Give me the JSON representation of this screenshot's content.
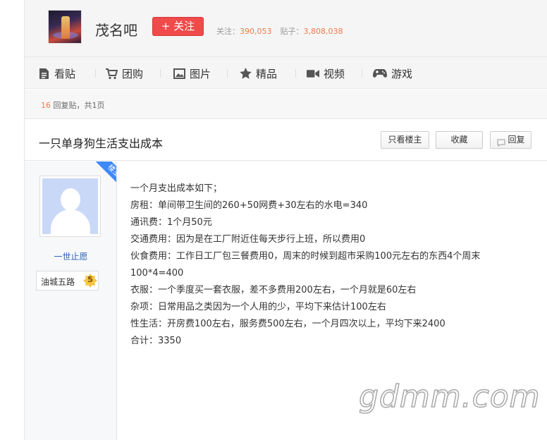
{
  "forum": {
    "name": "茂名吧",
    "follow_label": "+ 关注",
    "followers_label": "关注：",
    "followers": "390,053",
    "posts_label": "贴子：",
    "posts": "3,808,038"
  },
  "nav": {
    "items": [
      {
        "label": "看贴",
        "icon": "document-icon"
      },
      {
        "label": "团购",
        "icon": "cart-icon"
      },
      {
        "label": "图片",
        "icon": "image-icon"
      },
      {
        "label": "精品",
        "icon": "star-icon"
      },
      {
        "label": "视频",
        "icon": "video-icon"
      },
      {
        "label": "游戏",
        "icon": "gamepad-icon"
      }
    ]
  },
  "thread": {
    "reply_count": "16",
    "reply_suffix": "回复贴，共1页",
    "title": "一只单身狗生活支出成本",
    "buttons": {
      "only_op": "只看楼主",
      "favorite": "收藏",
      "reply": "回复"
    }
  },
  "author": {
    "ribbon": "楼主",
    "name": "一世止愿",
    "badge_label": "油城五路",
    "level": "5"
  },
  "post": {
    "lines": [
      "一个月支出成本如下；",
      "房租：单间带卫生间的260+50网费+30左右的水电=340",
      "通讯费：1个月50元",
      "交通费用：因为是在工厂附近住每天步行上班，所以费用0",
      "伙食费用：工作日工厂包三餐费用0，周末的时候到超市采购100元左右的东西4个周末",
      "100*4=400",
      "衣服：一个季度买一套衣服，差不多费用200左右，一个月就是60左右",
      "杂项：日常用品之类因为一个人用的少，平均下来估计100左右",
      "性生活：开房费100左右，服务费500左右，一个月四次以上，平均下来2400",
      "合计：3350"
    ]
  },
  "watermark": "gdmm.com",
  "colors": {
    "accent_red": "#f04a4a",
    "link_blue": "#2d64b3",
    "number_orange": "#f07a4a",
    "ribbon_blue": "#3e89fa"
  }
}
